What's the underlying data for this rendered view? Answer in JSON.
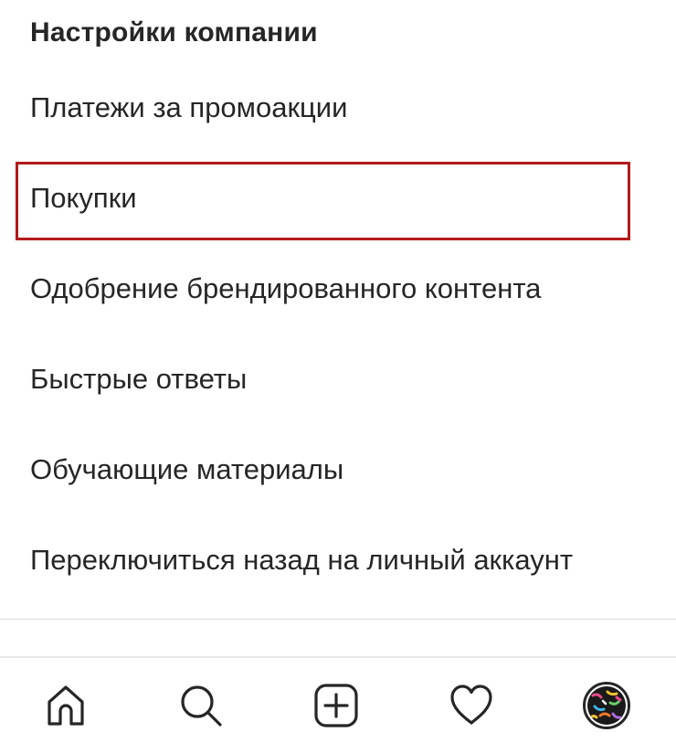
{
  "section": {
    "title": "Настройки компании"
  },
  "menu": {
    "items": [
      {
        "label": "Платежи за промоакции"
      },
      {
        "label": "Покупки"
      },
      {
        "label": "Одобрение брендированного контента"
      },
      {
        "label": "Быстрые ответы"
      },
      {
        "label": "Обучающие материалы"
      },
      {
        "label": "Переключиться назад на личный аккаунт"
      }
    ]
  },
  "tabbar": {
    "tabs": [
      {
        "icon": "home-icon"
      },
      {
        "icon": "search-icon"
      },
      {
        "icon": "add-post-icon"
      },
      {
        "icon": "heart-icon"
      },
      {
        "icon": "profile-avatar"
      }
    ]
  },
  "colors": {
    "text": "#262626",
    "highlight_border": "#b31b1b",
    "divider": "#dbdbdb"
  }
}
